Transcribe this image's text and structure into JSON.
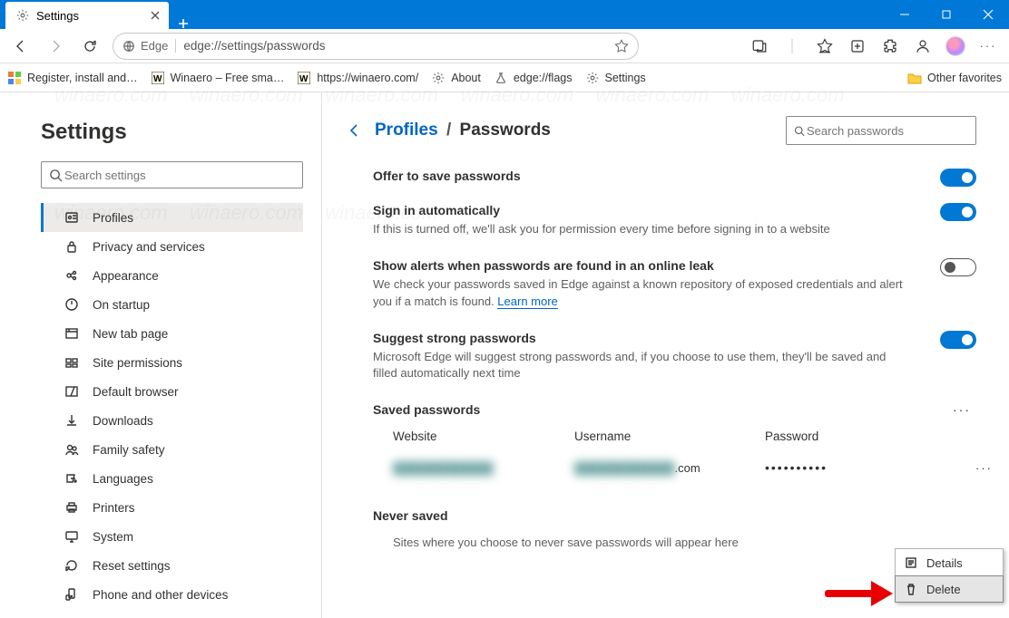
{
  "window": {
    "tab_title": "Settings",
    "address_identity": "Edge",
    "address_url": "edge://settings/passwords"
  },
  "bookmarks": {
    "items": [
      {
        "label": "Register, install and…",
        "icon": "tile-red"
      },
      {
        "label": "Winaero – Free sma…",
        "icon": "winaero"
      },
      {
        "label": "https://winaero.com/",
        "icon": "winaero"
      },
      {
        "label": "About",
        "icon": "gear"
      },
      {
        "label": "edge://flags",
        "icon": "flask"
      },
      {
        "label": "Settings",
        "icon": "gear"
      }
    ],
    "other": "Other favorites"
  },
  "sidebar": {
    "title": "Settings",
    "search_placeholder": "Search settings",
    "items": [
      "Profiles",
      "Privacy and services",
      "Appearance",
      "On startup",
      "New tab page",
      "Site permissions",
      "Default browser",
      "Downloads",
      "Family safety",
      "Languages",
      "Printers",
      "System",
      "Reset settings",
      "Phone and other devices"
    ],
    "active_index": 0
  },
  "page": {
    "breadcrumb_root": "Profiles",
    "breadcrumb_leaf": "Passwords",
    "search_placeholder": "Search passwords",
    "settings": {
      "offer_save": {
        "title": "Offer to save passwords",
        "state": true
      },
      "auto_signin": {
        "title": "Sign in automatically",
        "desc": "If this is turned off, we'll ask you for permission every time before signing in to a website",
        "state": true
      },
      "leak_alerts": {
        "title": "Show alerts when passwords are found in an online leak",
        "desc": "We check your passwords saved in Edge against a known repository of exposed credentials and alert you if a match is found. ",
        "learn": "Learn more",
        "state": false
      },
      "suggest": {
        "title": "Suggest strong passwords",
        "desc": "Microsoft Edge will suggest strong passwords and, if you choose to use them, they'll be saved and filled automatically next time",
        "state": true
      }
    },
    "saved": {
      "heading": "Saved passwords",
      "cols": {
        "site": "Website",
        "user": "Username",
        "pass": "Password"
      },
      "row": {
        "site_blur": "████████████",
        "user_blur": "████████████",
        "user_suffix": ".com",
        "pass": "••••••••••"
      }
    },
    "never": {
      "heading": "Never saved",
      "desc": "Sites where you choose to never save passwords will appear here"
    },
    "context_menu": {
      "details": "Details",
      "delete": "Delete"
    }
  }
}
